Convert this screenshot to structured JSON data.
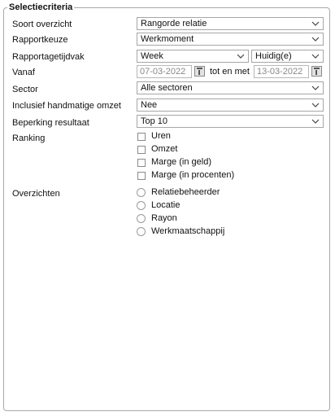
{
  "panel": {
    "title": "Selectiecriteria"
  },
  "fields": {
    "soort_overzicht": {
      "label": "Soort overzicht",
      "value": "Rangorde relatie"
    },
    "rapportkeuze": {
      "label": "Rapportkeuze",
      "value": "Werkmoment"
    },
    "rapportagetijdvak": {
      "label": "Rapportagetijdvak",
      "period": "Week",
      "relative": "Huidig(e)"
    },
    "vanaf": {
      "label": "Vanaf",
      "from": "07-03-2022",
      "separator": "tot en met",
      "to": "13-03-2022"
    },
    "sector": {
      "label": "Sector",
      "value": "Alle sectoren"
    },
    "handmatige_omzet": {
      "label": "Inclusief handmatige omzet",
      "value": "Nee"
    },
    "beperking_resultaat": {
      "label": "Beperking resultaat",
      "value": "Top 10"
    }
  },
  "ranking": {
    "label": "Ranking",
    "options": [
      "Uren",
      "Omzet",
      "Marge (in geld)",
      "Marge (in procenten)"
    ]
  },
  "overzichten": {
    "label": "Overzichten",
    "options": [
      "Relatiebeheerder",
      "Locatie",
      "Rayon",
      "Werkmaatschappij"
    ]
  }
}
